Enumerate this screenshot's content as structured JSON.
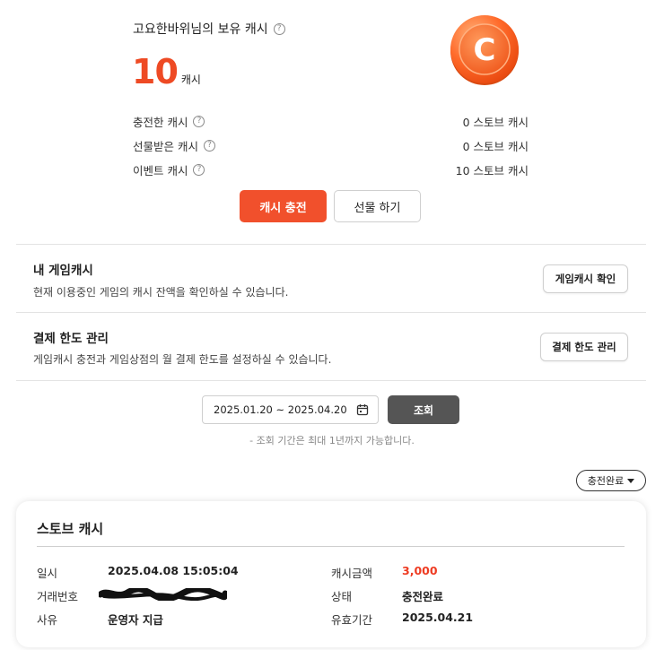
{
  "summary": {
    "title": "고요한바위님의 보유 캐시",
    "help": "?",
    "balance": "10",
    "balance_unit": "캐시",
    "coin_letter": "C",
    "rows": [
      {
        "label": "충전한 캐시",
        "value": "0 스토브 캐시"
      },
      {
        "label": "선물받은 캐시",
        "value": "0 스토브 캐시"
      },
      {
        "label": "이벤트 캐시",
        "value": "10 스토브 캐시"
      }
    ],
    "charge_label": "캐시 충전",
    "gift_label": "선물 하기"
  },
  "game_cash": {
    "title": "내 게임캐시",
    "desc": "현재 이용중인 게임의 캐시 잔액을 확인하실 수 있습니다.",
    "button": "게임캐시 확인"
  },
  "limit": {
    "title": "결제 한도 관리",
    "desc": "게임캐시 충전과 게임상점의 월 결제 한도를 설정하실 수 있습니다.",
    "button": "결제 한도 관리"
  },
  "query": {
    "date_range": "2025.01.20 ~ 2025.04.20",
    "button": "조회",
    "note": "- 조회 기간은 최대 1년까지 가능합니다."
  },
  "filter": {
    "selected": "충전완료"
  },
  "card": {
    "title": "스토브 캐시",
    "date_label": "일시",
    "date_value": "2025.04.08 15:05:04",
    "txn_label": "거래번호",
    "reason_label": "사유",
    "reason_value": "운영자 지급",
    "amount_label": "캐시금액",
    "amount_value": "3,000",
    "status_label": "상태",
    "status_value": "충전완료",
    "expiry_label": "유효기간",
    "expiry_value": "2025.04.21"
  },
  "colors": {
    "accent": "#f1502c",
    "amount_red": "#ee3b22",
    "query_button": "#555555"
  },
  "icons": [
    "help-icon",
    "cash-coin-icon",
    "calendar-icon",
    "caret-down-icon"
  ]
}
